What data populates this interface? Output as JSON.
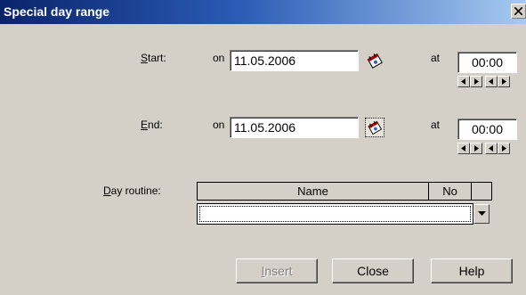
{
  "window": {
    "title": "Special day range",
    "close_glyph": "×"
  },
  "start": {
    "label_mnemonic": "S",
    "label_rest": "tart:",
    "on_label": "on",
    "date": "11.05.2006",
    "at_label": "at",
    "time": "00:00"
  },
  "end": {
    "label_mnemonic": "E",
    "label_rest": "nd:",
    "on_label": "on",
    "date": "11.05.2006",
    "at_label": "at",
    "time": "00:00"
  },
  "day_routine": {
    "label_mnemonic": "D",
    "label_rest": "ay routine:",
    "columns": [
      "Name",
      "No"
    ],
    "selected_value": ""
  },
  "buttons": {
    "insert": "Insert",
    "insert_mnemonic": "I",
    "insert_rest": "nsert",
    "close": "Close",
    "help": "Help"
  },
  "icons": {
    "calendar": "calendar-icon",
    "spin_left": "arrow-left-icon",
    "spin_right": "arrow-right-icon",
    "dropdown": "chevron-down-icon"
  }
}
